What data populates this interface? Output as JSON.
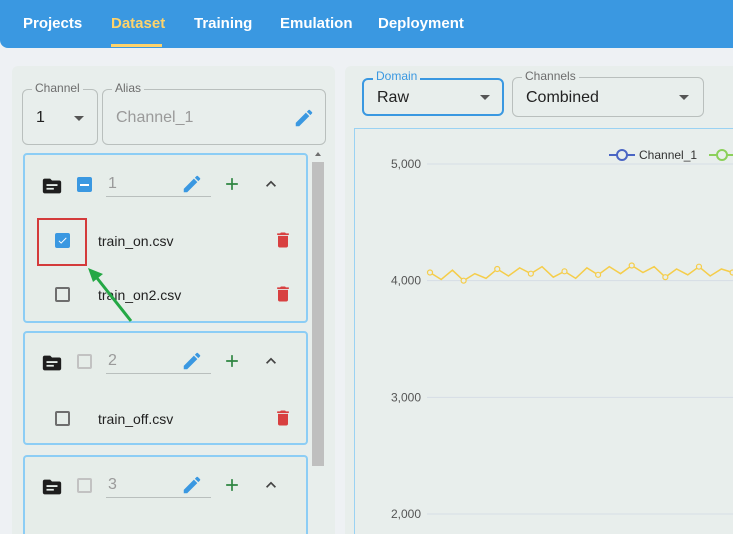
{
  "nav": {
    "tabs": [
      {
        "label": "Projects"
      },
      {
        "label": "Dataset"
      },
      {
        "label": "Training"
      },
      {
        "label": "Emulation"
      },
      {
        "label": "Deployment"
      }
    ],
    "active_tab": "Dataset"
  },
  "channel_select": {
    "label": "Channel",
    "value": "1"
  },
  "alias_field": {
    "label": "Alias",
    "value": "Channel_1"
  },
  "groups": [
    {
      "number": "1",
      "select_state": "indeterminate",
      "files": [
        {
          "name": "train_on.csv",
          "checked": true,
          "highlighted": true
        },
        {
          "name": "train_on2.csv",
          "checked": false
        }
      ]
    },
    {
      "number": "2",
      "select_state": "unchecked",
      "files": [
        {
          "name": "train_off.csv",
          "checked": false
        }
      ]
    },
    {
      "number": "3",
      "select_state": "unchecked",
      "files": []
    }
  ],
  "domain_select": {
    "label": "Domain",
    "value": "Raw"
  },
  "channels_select": {
    "label": "Channels",
    "value": "Combined"
  },
  "chart_data": {
    "type": "line",
    "legend": [
      "Channel_1"
    ],
    "legend_placement": "top-right",
    "y_ticks": [
      "5,000",
      "4,000",
      "3,000",
      "2,000"
    ],
    "series": [
      {
        "name": "Channel_1",
        "color": "#f5cd4a",
        "values": [
          4070,
          4010,
          4090,
          4000,
          4060,
          4020,
          4100,
          4040,
          4110,
          4060,
          4120,
          4030,
          4080,
          4020,
          4110,
          4050,
          4120,
          4060,
          4130,
          4070,
          4120,
          4030,
          4100,
          4050,
          4120,
          4040,
          4100,
          4070,
          4130,
          4060
        ]
      }
    ],
    "ylim": [
      1700,
      5300
    ],
    "grid": true
  },
  "colors": {
    "accent": "#3a98e1",
    "active_tab": "#ffd36a",
    "add": "#2e8540",
    "delete": "#d84040",
    "highlight_box": "#d43b3b",
    "annotation_arrow": "#24a845"
  },
  "icons": {
    "folder": "folder-open-icon",
    "edit": "pencil-icon",
    "add": "plus-icon",
    "collapse": "chevron-up-icon",
    "delete": "trash-icon"
  }
}
